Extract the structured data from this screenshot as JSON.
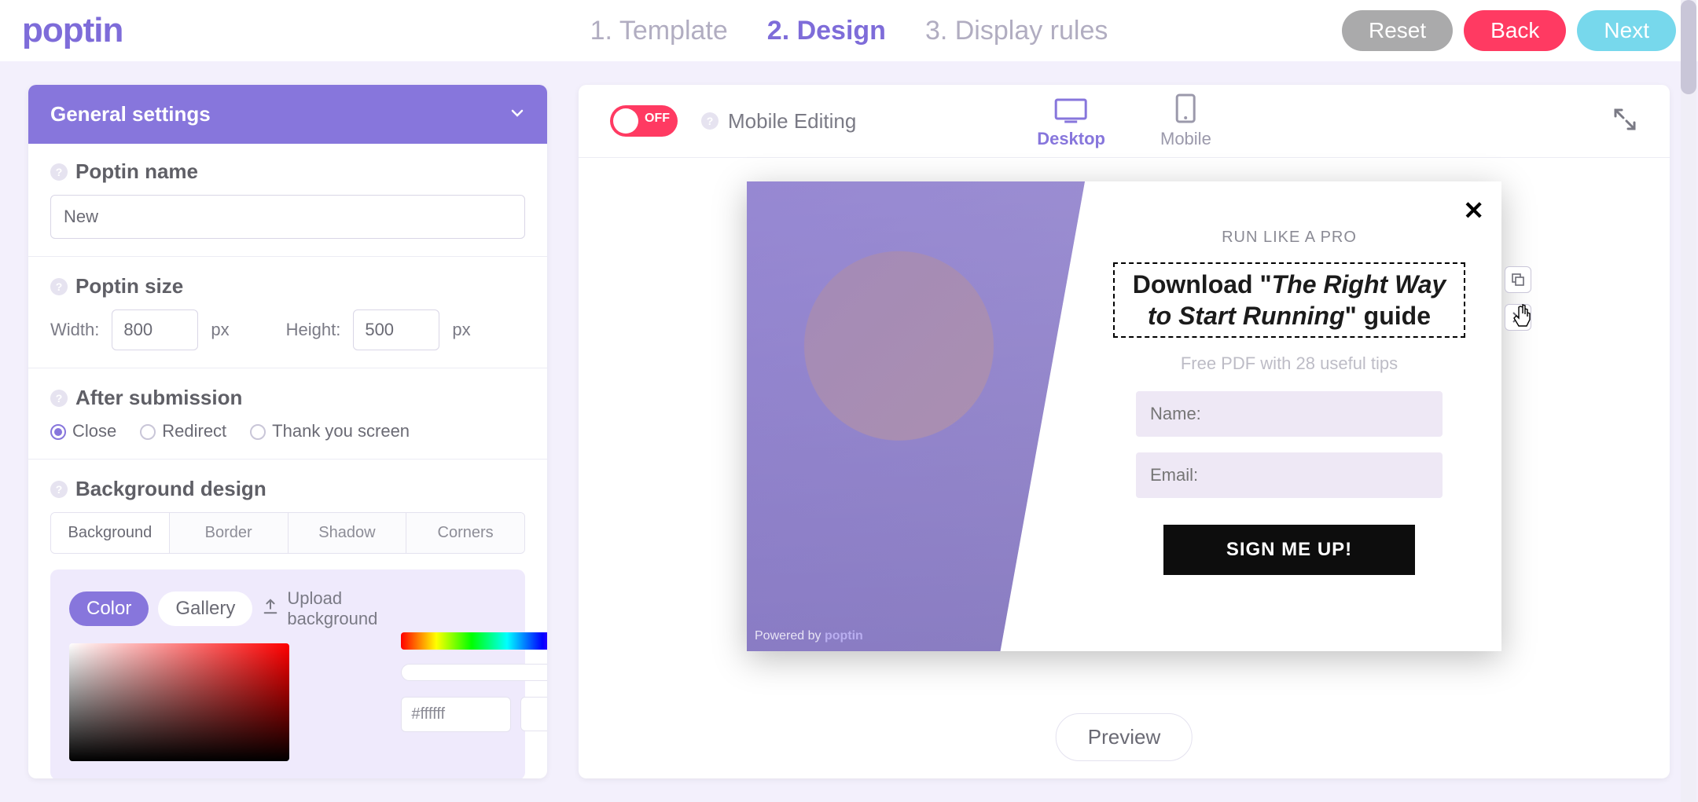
{
  "brand": "poptin",
  "steps": [
    {
      "label": "1. Template",
      "active": false
    },
    {
      "label": "2. Design",
      "active": true
    },
    {
      "label": "3. Display rules",
      "active": false
    }
  ],
  "header_buttons": {
    "reset": "Reset",
    "back": "Back",
    "next": "Next"
  },
  "sidebar": {
    "section_title": "General settings",
    "name_label": "Poptin name",
    "name_value": "New",
    "size_label": "Poptin size",
    "width_label": "Width:",
    "width_value": "800",
    "height_label": "Height:",
    "height_value": "500",
    "px_unit": "px",
    "after_label": "After submission",
    "after_options": [
      "Close",
      "Redirect",
      "Thank you screen"
    ],
    "after_selected": "Close",
    "bg_label": "Background design",
    "bg_tabs": [
      "Background",
      "Border",
      "Shadow",
      "Corners"
    ],
    "bg_tab_active": "Background",
    "picker": {
      "modes": [
        "Color",
        "Gallery"
      ],
      "mode_active": "Color",
      "upload_label": "Upload background",
      "hex": "#ffffff"
    }
  },
  "canvas": {
    "toggle_state": "OFF",
    "mobile_editing_label": "Mobile Editing",
    "devices": [
      {
        "label": "Desktop",
        "active": true
      },
      {
        "label": "Mobile",
        "active": false
      }
    ],
    "preview_label": "Preview"
  },
  "popup": {
    "eyebrow": "RUN LIKE A PRO",
    "headline_pre": "Download \"",
    "headline_italic": "The Right Way to Start Running",
    "headline_post": "\" guide",
    "subhead": "Free PDF with 28 useful tips",
    "name_placeholder": "Name:",
    "email_placeholder": "Email:",
    "cta": "SIGN ME UP!",
    "powered": "Powered by",
    "powered_brand": "poptin"
  }
}
